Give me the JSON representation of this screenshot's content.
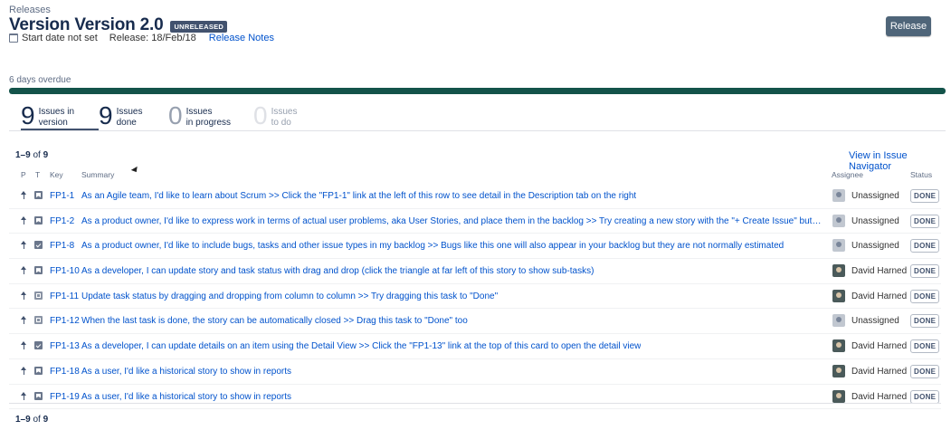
{
  "breadcrumb": "Releases",
  "title": "Version Version 2.0",
  "status_lozenge": "UNRELEASED",
  "meta": {
    "start_date": "Start date not set",
    "release": "Release: 18/Feb/18",
    "release_notes": "Release Notes"
  },
  "release_button": "Release",
  "overdue_text": "6 days overdue",
  "progress_fraction": 1.0,
  "progress_color": "#13534a",
  "stats": [
    {
      "num": "9",
      "label1": "Issues in",
      "label2": "version"
    },
    {
      "num": "9",
      "label1": "Issues",
      "label2": "done"
    },
    {
      "num": "0",
      "label1": "Issues",
      "label2": "in progress"
    },
    {
      "num": "0",
      "label1": "Issues",
      "label2": "to do"
    }
  ],
  "count_top": {
    "range": "1–9",
    "of": "of",
    "total": "9"
  },
  "count_bottom": {
    "range": "1–9",
    "of": "of",
    "total": "9"
  },
  "view_in_navigator": "View in Issue Navigator",
  "columns": {
    "p": "P",
    "t": "T",
    "key": "Key",
    "summary": "Summary",
    "assignee": "Assignee",
    "status": "Status"
  },
  "issues": [
    {
      "type": "story",
      "key": "FP1-1",
      "summary": "As an Agile team, I'd like to learn about Scrum >> Click the \"FP1-1\" link at the left of this row to see detail in the Description tab on the right",
      "assignee": "Unassigned",
      "avatar": "default",
      "status": "DONE"
    },
    {
      "type": "story",
      "key": "FP1-2",
      "summary": "As a product owner, I'd like to express work in terms of actual user problems, aka User Stories, and place them in the backlog >> Try creating a new story with the \"+ Create Issue\" button (to...",
      "assignee": "Unassigned",
      "avatar": "default",
      "status": "DONE"
    },
    {
      "type": "task",
      "key": "FP1-8",
      "summary": "As a product owner, I'd like to include bugs, tasks and other issue types in my backlog >> Bugs like this one will also appear in your backlog but they are not normally estimated",
      "assignee": "Unassigned",
      "avatar": "default",
      "status": "DONE"
    },
    {
      "type": "story",
      "key": "FP1-10",
      "summary": "As a developer, I can update story and task status with drag and drop (click the triangle at far left of this story to show sub-tasks)",
      "assignee": "David Harned",
      "avatar": "person",
      "status": "DONE"
    },
    {
      "type": "sub",
      "key": "FP1-11",
      "summary": "Update task status by dragging and dropping from column to column >> Try dragging this task to \"Done\"",
      "assignee": "David Harned",
      "avatar": "person",
      "status": "DONE"
    },
    {
      "type": "sub",
      "key": "FP1-12",
      "summary": "When the last task is done, the story can be automatically closed >> Drag this task to \"Done\" too",
      "assignee": "Unassigned",
      "avatar": "default",
      "status": "DONE"
    },
    {
      "type": "task",
      "key": "FP1-13",
      "summary": "As a developer, I can update details on an item using the Detail View >> Click the \"FP1-13\" link at the top of this card to open the detail view",
      "assignee": "David Harned",
      "avatar": "person",
      "status": "DONE"
    },
    {
      "type": "story",
      "key": "FP1-18",
      "summary": "As a user, I'd like a historical story to show in reports",
      "assignee": "David Harned",
      "avatar": "person",
      "status": "DONE"
    },
    {
      "type": "story",
      "key": "FP1-19",
      "summary": "As a user, I'd like a historical story to show in reports",
      "assignee": "David Harned",
      "avatar": "person",
      "status": "DONE"
    }
  ]
}
